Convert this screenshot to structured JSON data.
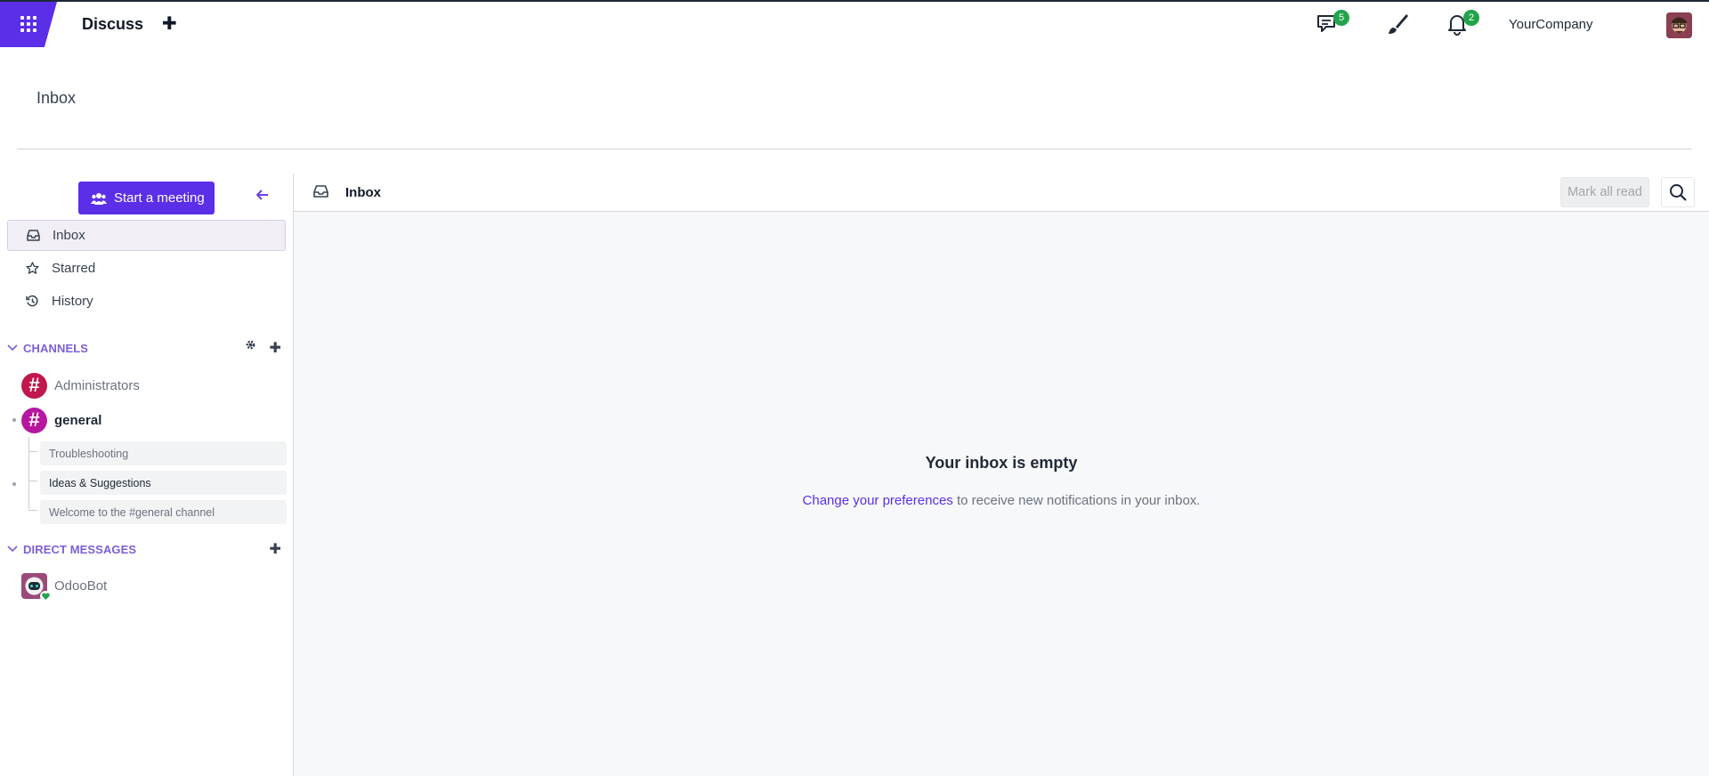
{
  "navbar": {
    "app_name": "Discuss",
    "new_icon": "plus-icon",
    "messages_badge": "5",
    "notifications_badge": "2",
    "company": "YourCompany",
    "accent": "#5b2ee8"
  },
  "control_panel": {
    "breadcrumb": "Inbox"
  },
  "sidebar": {
    "meeting_button": "Start a meeting",
    "mailboxes": [
      {
        "label": "Inbox",
        "icon": "inbox-icon",
        "active": true
      },
      {
        "label": "Starred",
        "icon": "star-icon"
      },
      {
        "label": "History",
        "icon": "history-icon"
      }
    ],
    "channels_header": "CHANNELS",
    "channels": [
      {
        "name": "Administrators",
        "color": "#c0174c"
      },
      {
        "name": "general",
        "color": "#b5179e"
      }
    ],
    "threads": [
      {
        "name": "Troubleshooting"
      },
      {
        "name": "Ideas & Suggestions"
      },
      {
        "name": "Welcome to the #general channel"
      }
    ],
    "dm_header": "DIRECT MESSAGES",
    "direct_messages": [
      {
        "name": "OdooBot",
        "status": "online"
      }
    ]
  },
  "main": {
    "title": "Inbox",
    "mark_all_read": "Mark all read",
    "empty_title": "Your inbox is empty",
    "empty_link": "Change your preferences",
    "empty_rest": " to receive new notifications in your inbox."
  }
}
